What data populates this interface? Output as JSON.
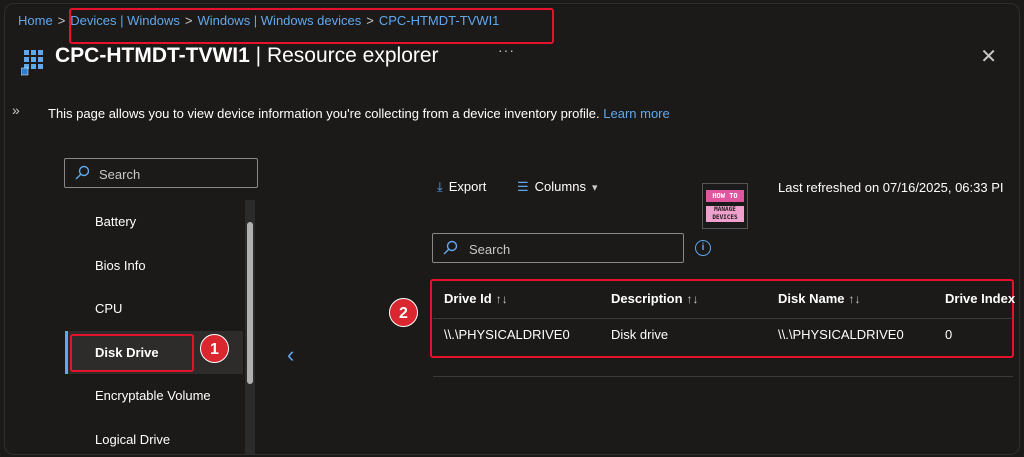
{
  "breadcrumb": {
    "items": [
      "Home",
      "Devices | Windows",
      "Windows | Windows devices",
      "CPC-HTMDT-TVWI1"
    ],
    "separator": ">"
  },
  "header": {
    "device_name": "CPC-HTMDT-TVWI1",
    "title_suffix": "| Resource explorer",
    "more_label": "···",
    "close_label": "✕",
    "expand_label": "»"
  },
  "description": {
    "text": "This page allows you to view device information you're collecting from a device inventory profile.",
    "link": "Learn more"
  },
  "nav": {
    "search_placeholder": "Search",
    "items": [
      "Battery",
      "Bios Info",
      "CPU",
      "Disk Drive",
      "Encryptable Volume",
      "Logical Drive"
    ],
    "active_index": 3
  },
  "toolbar": {
    "export_label": "Export",
    "columns_label": "Columns",
    "last_refreshed": "Last refreshed on 07/16/2025, 06:33 PI"
  },
  "logo": {
    "line1": "HOW TO",
    "line2": "MANAGE DEVICES"
  },
  "grid": {
    "search_placeholder": "Search",
    "columns": [
      "Drive Id",
      "Description",
      "Disk Name",
      "Drive Index"
    ],
    "rows": [
      [
        "\\\\.\\PHYSICALDRIVE0",
        "Disk drive",
        "\\\\.\\PHYSICALDRIVE0",
        "0"
      ]
    ]
  },
  "annotations": {
    "badge_1": "1",
    "badge_2": "2"
  },
  "colors": {
    "accent": "#5fa8f0",
    "highlight": "#e8112d",
    "background": "#1b1a19"
  }
}
